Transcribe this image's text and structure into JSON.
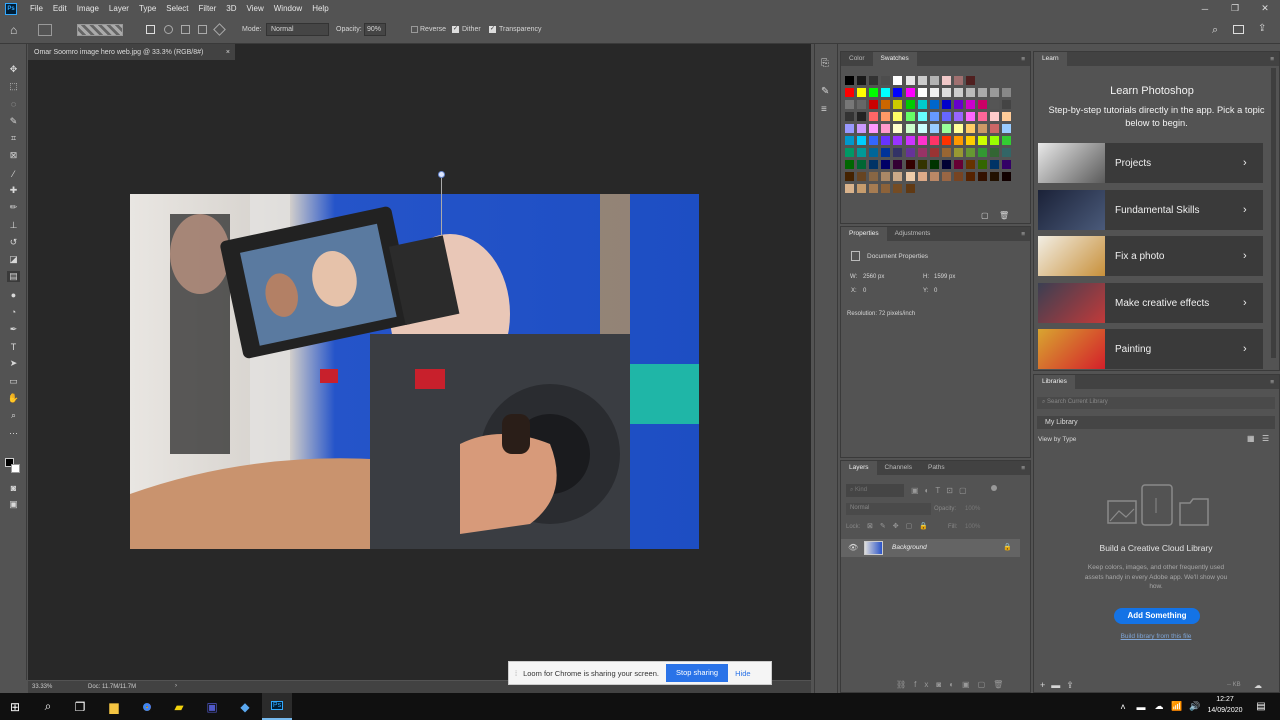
{
  "app": {
    "logo": "Ps"
  },
  "menubar": {
    "items": [
      "File",
      "Edit",
      "Image",
      "Layer",
      "Type",
      "Select",
      "Filter",
      "3D",
      "View",
      "Window",
      "Help"
    ]
  },
  "options": {
    "mode_label": "Mode:",
    "mode_value": "Normal",
    "opacity_label": "Opacity:",
    "opacity_value": "90%",
    "reverse_label": "Reverse",
    "dither_label": "Dither",
    "transparency_label": "Transparency"
  },
  "document": {
    "tab_title": "Omar Soomro image hero web.jpg @ 33.3% (RGB/8#)",
    "close": "×"
  },
  "status": {
    "zoom": "33.33%",
    "doc": "Doc: 11.7M/11.7M",
    "arrow": "›"
  },
  "swatches_panel": {
    "tabs": [
      "Color",
      "Swatches"
    ],
    "active": "Swatches"
  },
  "properties_panel": {
    "tabs": [
      "Properties",
      "Adjustments"
    ],
    "heading": "Document Properties",
    "w_label": "W:",
    "w_value": "2560 px",
    "h_label": "H:",
    "h_value": "1599 px",
    "x_label": "X:",
    "x_value": "0",
    "y_label": "Y:",
    "y_value": "0",
    "resolution": "Resolution: 72 pixels/inch"
  },
  "layers_panel": {
    "tabs": [
      "Layers",
      "Channels",
      "Paths"
    ],
    "kind_placeholder": "Kind",
    "blend": "Normal",
    "opacity_label": "Opacity:",
    "opacity_value": "100%",
    "lock_label": "Lock:",
    "fill_label": "Fill:",
    "fill_value": "100%",
    "layer_name": "Background"
  },
  "learn_panel": {
    "tab": "Learn",
    "title": "Learn Photoshop",
    "subtitle": "Step-by-step tutorials directly in the app. Pick a topic below to begin.",
    "topics": [
      "Projects",
      "Fundamental Skills",
      "Fix a photo",
      "Make creative effects",
      "Painting"
    ]
  },
  "libraries_panel": {
    "tab": "Libraries",
    "search_placeholder": "Search Current Library",
    "library": "My Library",
    "view_by": "View by Type",
    "empty_title": "Build a Creative Cloud Library",
    "empty_text": "Keep colors, images, and other frequently used assets handy in every Adobe app. We'll show you how.",
    "add_button": "Add Something",
    "build_link": "Build library from this file",
    "size": "-- KB"
  },
  "loom": {
    "message": "Loom for Chrome is sharing your screen.",
    "stop": "Stop sharing",
    "hide": "Hide"
  },
  "taskbar": {
    "time": "12:27",
    "date": "14/09/2020"
  },
  "colors": {
    "ui_bg": "#535353",
    "canvas_bg": "#282828",
    "accent_blue": "#1473e6",
    "loom_blue": "#2a73e8"
  }
}
